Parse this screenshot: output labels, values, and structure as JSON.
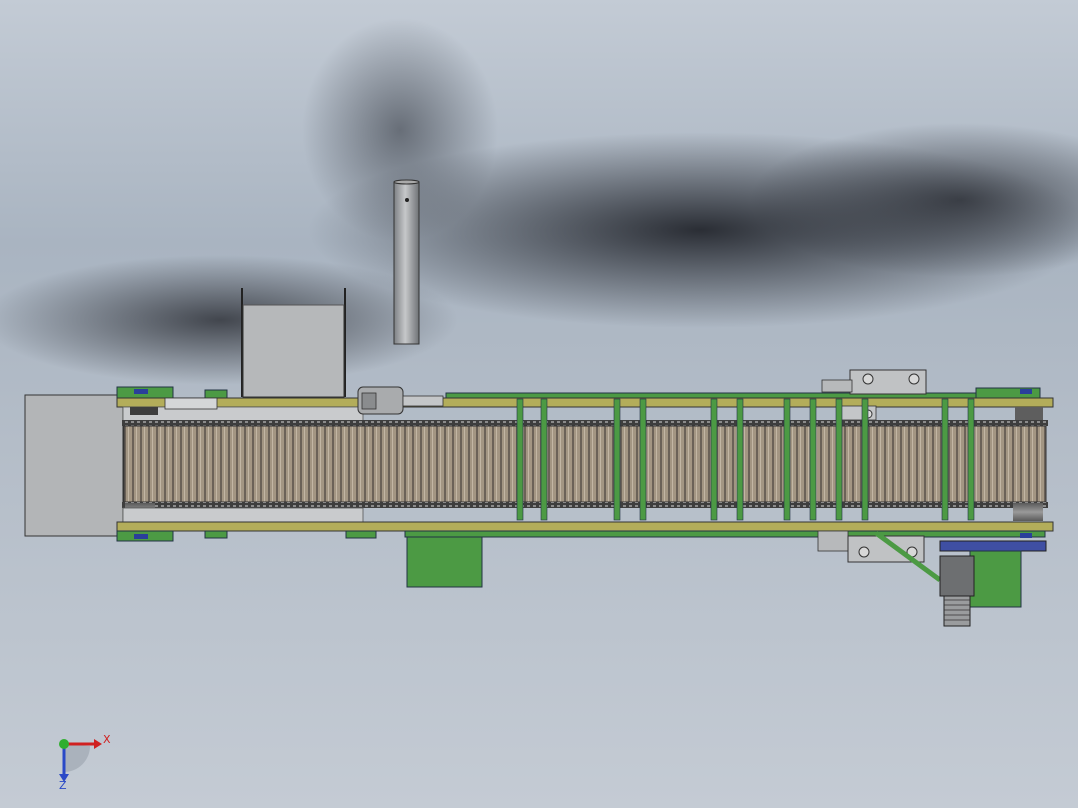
{
  "view": {
    "colors": {
      "frame_green": "#4c9a44",
      "rail_olive": "#b3ad5a",
      "belt_brown": "#9c9080",
      "housing_gray": "#b2b4b6",
      "shadow": "#1e2026",
      "motor_blue": "#3f4fa3",
      "axis_x": "#d02020",
      "axis_y": "#2fae2f",
      "axis_z": "#2a49c7"
    }
  },
  "triad": {
    "x_label": "X",
    "z_label": "Z"
  }
}
